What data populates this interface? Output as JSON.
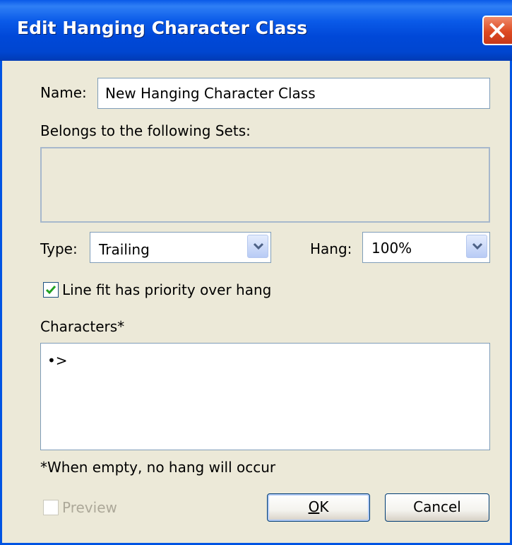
{
  "dialog": {
    "title": "Edit Hanging Character Class"
  },
  "name": {
    "label": "Name:",
    "value": "New Hanging Character Class"
  },
  "sets": {
    "label": "Belongs to the following Sets:"
  },
  "type": {
    "label": "Type:",
    "value": "Trailing"
  },
  "hang": {
    "label": "Hang:",
    "value": "100%"
  },
  "line_fit": {
    "label": "Line fit has priority over hang",
    "checked": true
  },
  "characters": {
    "label": "Characters*",
    "value": "•>",
    "note": "*When empty, no hang will occur"
  },
  "preview": {
    "label": "Preview",
    "checked": false,
    "enabled": false
  },
  "buttons": {
    "ok_prefix": "O",
    "ok_rest": "K",
    "cancel": "Cancel"
  },
  "colors": {
    "title_bar": "#0054e3",
    "dialog_bg": "#ece9d8",
    "check": "#21a121",
    "close": "#dd4a22"
  },
  "icons": {
    "close": "close-icon",
    "dropdown": "chevron-down-icon",
    "check": "checkmark-icon"
  }
}
